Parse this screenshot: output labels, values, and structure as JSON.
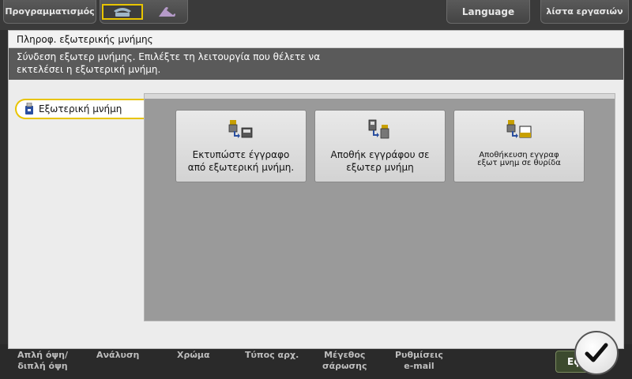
{
  "topbar": {
    "programming": "Προγραμματισμός",
    "fax_selected_icon": "fax-phone-icon",
    "fax_other_icon": "handset-icon",
    "language": "Language",
    "job_list": "λίστα εργασιών"
  },
  "bottom_tabs": [
    {
      "label": "Απλή όψη/\nδιπλή όψη"
    },
    {
      "label": "Ανάλυση"
    },
    {
      "label": "Χρώμα"
    },
    {
      "label": "Τύπος αρχ."
    },
    {
      "label": "Μέγεθος\nσάρωσης"
    },
    {
      "label": "Ρυθμίσεις\ne-mail"
    }
  ],
  "ok_button": {
    "label": "Εφ",
    "icon": "checkmark-icon"
  },
  "dialog": {
    "title": "Πληροφ. εξωτερικής μνήμης",
    "message_line1": "Σύνδεση εξωτερ μνήμης. Επιλέξτε τη λειτουργία που θέλετε να",
    "message_line2": "εκτελέσει η εξωτερική μνήμη.",
    "tab_label": "Εξωτερική μνήμη",
    "tab_icon": "usb-memory-icon",
    "functions": [
      {
        "label": "Εκτυπώστε έγγραφο\nαπό εξωτερική μνήμη.",
        "icon": "print-from-memory-icon"
      },
      {
        "label": "Αποθήκ εγγράφου σε\nεξωτερ μνήμη",
        "icon": "save-to-memory-icon"
      },
      {
        "label": "Αποθήκευση εγγραφ\nεξωτ μνημ σε θυρίδα",
        "icon": "save-to-box-icon"
      }
    ]
  },
  "colors": {
    "accent_yellow": "#e8c400",
    "message_bg": "#5a5a5a",
    "panel_bg": "#9a9a9a"
  }
}
